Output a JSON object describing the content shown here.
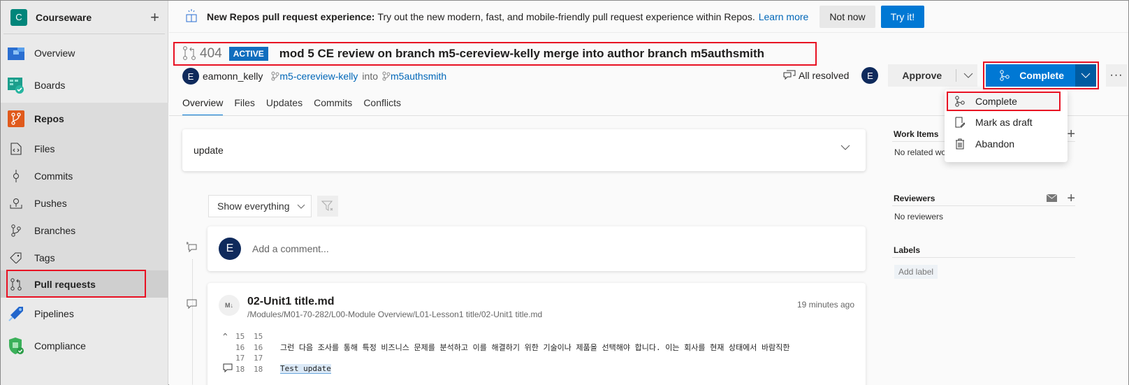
{
  "project": {
    "initial": "C",
    "name": "Courseware",
    "add_label": "+"
  },
  "sidebar": {
    "items": [
      {
        "label": "Overview",
        "icon": "overview-icon"
      },
      {
        "label": "Boards",
        "icon": "boards-icon"
      },
      {
        "label": "Repos",
        "icon": "repos-icon"
      },
      {
        "label": "Files",
        "icon": "files-icon"
      },
      {
        "label": "Commits",
        "icon": "commits-icon"
      },
      {
        "label": "Pushes",
        "icon": "pushes-icon"
      },
      {
        "label": "Branches",
        "icon": "branches-icon"
      },
      {
        "label": "Tags",
        "icon": "tags-icon"
      },
      {
        "label": "Pull requests",
        "icon": "pull-request-icon",
        "selected": true
      },
      {
        "label": "Pipelines",
        "icon": "pipelines-icon"
      },
      {
        "label": "Compliance",
        "icon": "compliance-icon"
      }
    ]
  },
  "banner": {
    "title": "New Repos pull request experience:",
    "text": "Try out the new modern, fast, and mobile-friendly pull request experience within Repos.",
    "link": "Learn more",
    "not_now": "Not now",
    "try_it": "Try it!"
  },
  "pr": {
    "id": "404",
    "status": "ACTIVE",
    "title": "mod 5 CE review on branch m5-cereview-kelly merge into author branch m5authsmith",
    "author_initial": "E",
    "author": "eamonn_kelly",
    "source_branch": "m5-cereview-kelly",
    "into": "into",
    "target_branch": "m5authsmith"
  },
  "actions": {
    "resolved": "All resolved",
    "reviewer_initial": "E",
    "approve": "Approve",
    "complete": "Complete",
    "more": "···"
  },
  "complete_menu": {
    "items": [
      {
        "label": "Complete",
        "icon": "merge-icon"
      },
      {
        "label": "Mark as draft",
        "icon": "draft-icon"
      },
      {
        "label": "Abandon",
        "icon": "trash-icon"
      }
    ]
  },
  "tabs": [
    "Overview",
    "Files",
    "Updates",
    "Commits",
    "Conflicts"
  ],
  "description": "update",
  "filter": {
    "selected": "Show everything"
  },
  "comment": {
    "avatar_initial": "E",
    "placeholder": "Add a comment..."
  },
  "file": {
    "badge": "M↓",
    "name": "02-Unit1 title.md",
    "path": "/Modules/M01-70-282/L00-Module Overview/L01-Lesson1 title/02-Unit1 title.md",
    "time": "19 minutes ago",
    "lines": [
      {
        "left": "15",
        "right": "15",
        "code": ""
      },
      {
        "left": "16",
        "right": "16",
        "code": "그런 다음 조사를 통해 특정 비즈니스 문제를 분석하고 이를 해결하기 위한 기술이나 제품을 선택해야 합니다. 이는 회사를 현재 상태에서 바람직한"
      },
      {
        "left": "17",
        "right": "17",
        "code": ""
      },
      {
        "left": "18",
        "right": "18",
        "code": "Test update"
      }
    ]
  },
  "right_panel": {
    "work_items": {
      "title": "Work Items",
      "empty": "No related work items"
    },
    "reviewers": {
      "title": "Reviewers",
      "empty": "No reviewers"
    },
    "labels": {
      "title": "Labels",
      "add": "Add label"
    }
  },
  "colors": {
    "accent": "#0078d4",
    "highlight_box": "#e81123",
    "project": "#00857a"
  }
}
